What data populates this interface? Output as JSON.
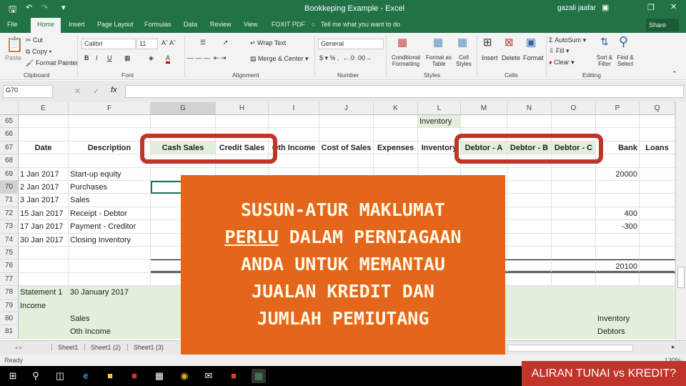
{
  "window": {
    "title": "Bookkeping Example - Excel",
    "user": "gazali jaafar",
    "share": "Share"
  },
  "ribbon_tabs": [
    "File",
    "Home",
    "Insert",
    "Page Layout",
    "Formulas",
    "Data",
    "Review",
    "View",
    "FOXIT PDF"
  ],
  "tell_me": "Tell me what you want to do",
  "clipboard": {
    "paste": "Paste",
    "cut": "Cut",
    "copy": "Copy",
    "format_painter": "Format Painter",
    "group": "Clipboard"
  },
  "font": {
    "name": "Calibri",
    "size": "11",
    "bold": "B",
    "italic": "I",
    "underline": "U",
    "group": "Font"
  },
  "alignment": {
    "wrap": "Wrap Text",
    "merge": "Merge & Center",
    "group": "Alignment"
  },
  "number": {
    "format": "General",
    "group": "Number"
  },
  "styles": {
    "conditional": "Conditional Formatting",
    "format_table": "Format as Table",
    "cell_styles": "Cell Styles",
    "group": "Styles"
  },
  "cells": {
    "insert": "Insert",
    "delete": "Delete",
    "format": "Format",
    "group": "Cells"
  },
  "editing": {
    "autosum": "AutoSum",
    "fill": "Fill",
    "clear": "Clear",
    "sort": "Sort & Filter",
    "find": "Find & Select",
    "group": "Editing"
  },
  "formula_bar": {
    "name_box": "G70",
    "value": ""
  },
  "columns": [
    "E",
    "F",
    "G",
    "H",
    "I",
    "J",
    "K",
    "L",
    "M",
    "N",
    "O",
    "P",
    "Q"
  ],
  "rows": [
    {
      "num": "65",
      "cells": {
        "L": "Inventory"
      }
    },
    {
      "num": "66",
      "cells": {}
    },
    {
      "num": "67",
      "cells": {
        "E": "Date",
        "F": "Description",
        "G": "Cash Sales",
        "H": "Credit Sales",
        "I": "Oth Income",
        "J": "Cost of Sales",
        "K": "Expenses",
        "L": "Inventory",
        "M": "Debtor - A",
        "N": "Debtor - B",
        "O": "Debtor - C",
        "P": "Bank",
        "Q": "Loans"
      }
    },
    {
      "num": "68",
      "cells": {}
    },
    {
      "num": "69",
      "cells": {
        "E": "1 Jan 2017",
        "F": "Start-up equity",
        "P": "20000"
      }
    },
    {
      "num": "70",
      "cells": {
        "E": "2 Jan 2017",
        "F": "Purchases"
      }
    },
    {
      "num": "71",
      "cells": {
        "E": "3 Jan 2017",
        "F": "Sales"
      }
    },
    {
      "num": "72",
      "cells": {
        "E": "15 Jan 2017",
        "F": "Receipt - Debtor",
        "P": "400"
      }
    },
    {
      "num": "73",
      "cells": {
        "E": "17 Jan 2017",
        "F": "Payment - Creditor",
        "P": "-300"
      }
    },
    {
      "num": "74",
      "cells": {
        "E": "30 Jan 2017",
        "F": "Closing Inventory"
      }
    },
    {
      "num": "75",
      "cells": {}
    },
    {
      "num": "76",
      "cells": {
        "P": "20100"
      }
    },
    {
      "num": "77",
      "cells": {}
    },
    {
      "num": "78",
      "cells": {
        "E": "Statement 1",
        "F": "30 January 2017"
      }
    },
    {
      "num": "79",
      "cells": {
        "E": "Income"
      }
    },
    {
      "num": "80",
      "cells": {
        "F": "Sales",
        "P": "Inventory"
      }
    },
    {
      "num": "81",
      "cells": {
        "F": "Oth Income",
        "P": "Debtors"
      }
    }
  ],
  "sheet_tabs": [
    "Sheet1",
    "Sheet1 (2)",
    "Sheet1 (3)"
  ],
  "status": {
    "ready": "Ready",
    "zoom": "130%"
  },
  "overlay": {
    "line1": "SUSUN-ATUR MAKLUMAT",
    "underlined": "PERLU",
    "line2_rest": " DALAM PERNIAGAAN",
    "line3": "ANDA UNTUK MEMANTAU",
    "line4": "JUALAN KREDIT DAN",
    "line5": "JUMLAH PEMIUTANG"
  },
  "caption": "ALIRAN TUNAI vs KREDIT?",
  "colors": {
    "excel_green": "#217346",
    "overlay_orange": "#e4661a",
    "highlight_red": "#c0342a",
    "cell_green": "#e2efda"
  },
  "taskbar_icons": [
    "windows-start-icon",
    "search-icon",
    "task-view-icon",
    "edge-icon",
    "file-explorer-icon",
    "acrobat-icon",
    "store-icon",
    "chrome-icon",
    "mail-icon",
    "powerpoint-icon",
    "excel-icon"
  ]
}
